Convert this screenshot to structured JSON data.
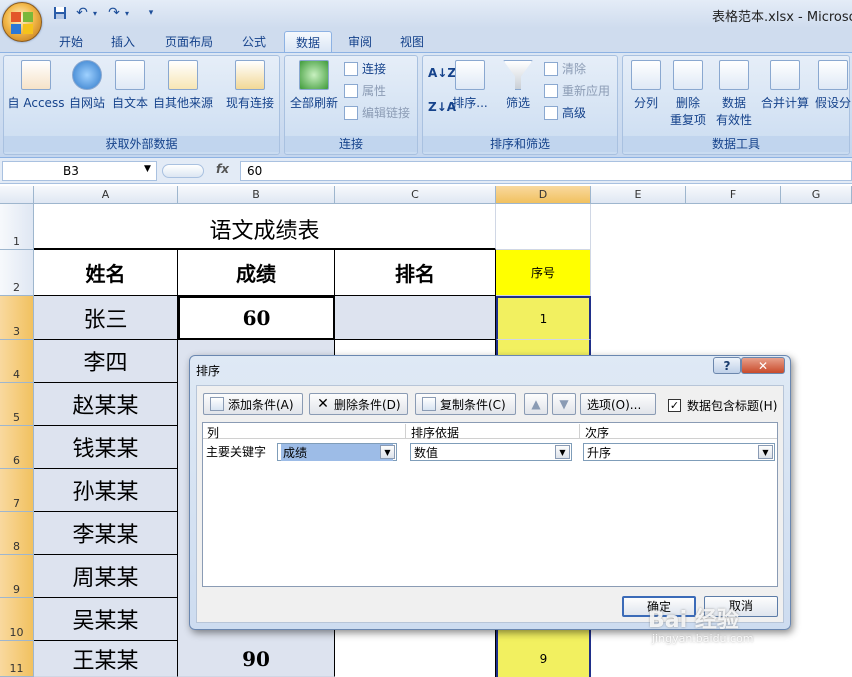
{
  "window": {
    "doc_title": "表格范本.xlsx - Microsof"
  },
  "tabs": [
    {
      "label": "开始"
    },
    {
      "label": "插入"
    },
    {
      "label": "页面布局"
    },
    {
      "label": "公式"
    },
    {
      "label": "数据",
      "active": true
    },
    {
      "label": "审阅"
    },
    {
      "label": "视图"
    }
  ],
  "ribbon": {
    "groups": {
      "external": {
        "label": "获取外部数据",
        "buttons": [
          "自 Access",
          "自网站",
          "自文本",
          "自其他来源",
          "现有连接"
        ]
      },
      "connections": {
        "label": "连接",
        "refresh_all": "全部刷新",
        "connections": "连接",
        "properties": "属性",
        "edit_links": "编辑链接"
      },
      "sort_filter": {
        "label": "排序和筛选",
        "sort": "排序...",
        "filter": "筛选",
        "clear": "清除",
        "reapply": "重新应用",
        "advanced": "高级"
      },
      "data_tools": {
        "label": "数据工具",
        "text_to_columns": "分列",
        "remove_duplicates_1": "删除",
        "remove_duplicates_2": "重复项",
        "validation_1": "数据",
        "validation_2": "有效性",
        "consolidate": "合并计算",
        "what_if": "假设分"
      }
    }
  },
  "formula_bar": {
    "name_box": "B3",
    "fx": "fx",
    "value": "60"
  },
  "sheet": {
    "columns": [
      "A",
      "B",
      "C",
      "D",
      "E",
      "F",
      "G"
    ],
    "selected_column": "D",
    "rows": [
      "1",
      "2",
      "3",
      "4",
      "5",
      "6",
      "7",
      "8",
      "9",
      "10",
      "11"
    ],
    "title": "语文成绩表",
    "headers": {
      "name": "姓名",
      "score": "成绩",
      "rank": "排名",
      "serial": "序号"
    },
    "data_rows": [
      {
        "name": "张三",
        "score": "60",
        "serial": "1"
      },
      {
        "name": "李四",
        "score": "",
        "serial": ""
      },
      {
        "name": "赵某某",
        "score": "",
        "serial": ""
      },
      {
        "name": "钱某某",
        "score": "",
        "serial": ""
      },
      {
        "name": "孙某某",
        "score": "",
        "serial": ""
      },
      {
        "name": "李某某",
        "score": "",
        "serial": ""
      },
      {
        "name": "周某某",
        "score": "",
        "serial": ""
      },
      {
        "name": "吴某某",
        "score": "",
        "serial": ""
      },
      {
        "name": "王某某",
        "score": "90",
        "serial": "9"
      }
    ]
  },
  "dialog": {
    "title": "排序",
    "help": "?",
    "close": "✕",
    "add_level": "添加条件(A)",
    "delete_level": "删除条件(D)",
    "copy_level": "复制条件(C)",
    "options": "选项(O)...",
    "has_headers": "数据包含标题(H)",
    "has_headers_checked": true,
    "col_header": "列",
    "sort_on_header": "排序依据",
    "order_header": "次序",
    "row_label": "主要关键字",
    "sort_by_value": "成绩",
    "sort_on_value": "数值",
    "order_value": "升序",
    "ok": "确定",
    "cancel": "取消"
  },
  "watermark": {
    "text": "Bai 经验",
    "sub": "jingyan.baidu.com"
  },
  "colors": {
    "yellow_fill": "#f7f75a",
    "header_fill": "#ffff00",
    "ribbon_blue": "#15428b"
  }
}
